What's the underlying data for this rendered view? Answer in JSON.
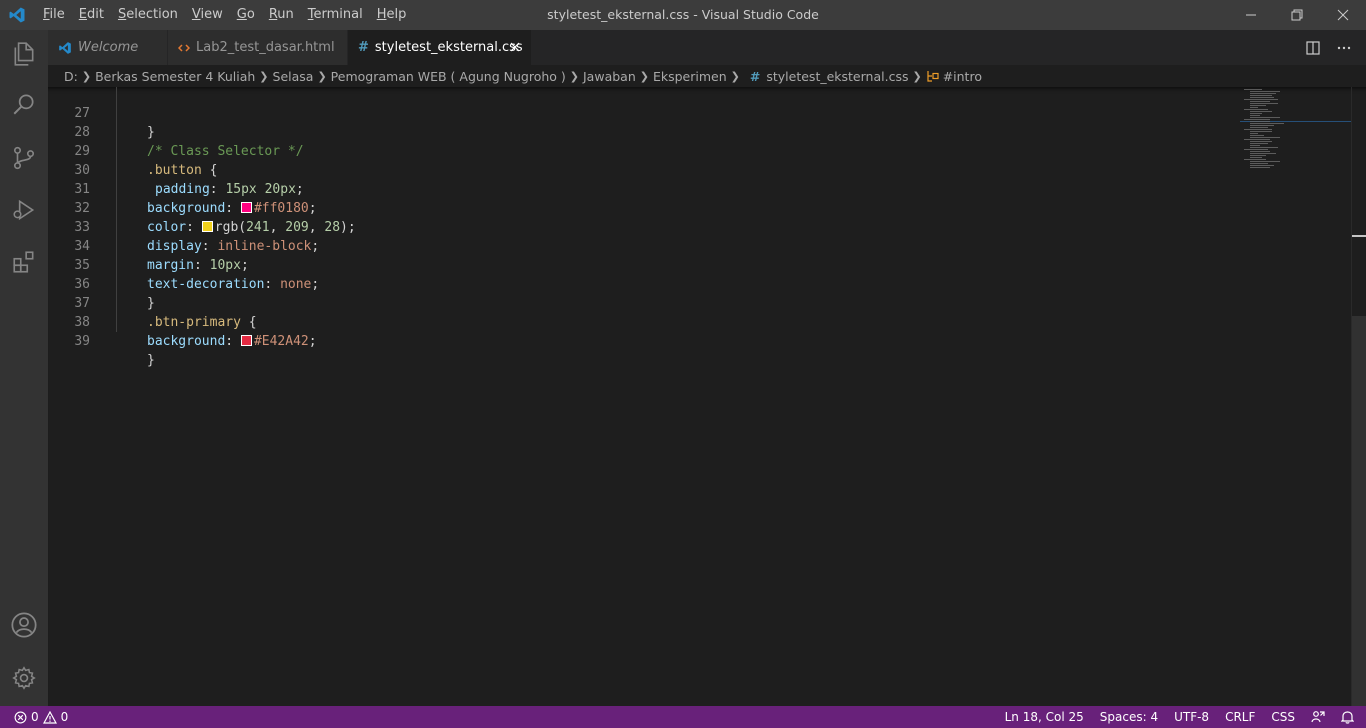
{
  "titlebar": {
    "title": "styletest_eksternal.css - Visual Studio Code",
    "menu": [
      {
        "mn": "F",
        "rest": "ile"
      },
      {
        "mn": "E",
        "rest": "dit"
      },
      {
        "mn": "S",
        "rest": "election"
      },
      {
        "mn": "V",
        "rest": "iew"
      },
      {
        "mn": "G",
        "rest": "o"
      },
      {
        "mn": "R",
        "rest": "un"
      },
      {
        "mn": "T",
        "rest": "erminal"
      },
      {
        "mn": "H",
        "rest": "elp"
      }
    ]
  },
  "activitybar": {
    "icons": [
      "explorer-icon",
      "search-icon",
      "source-control-icon",
      "run-debug-icon",
      "extensions-icon",
      "account-icon",
      "settings-gear-icon"
    ]
  },
  "tabs": [
    {
      "label": "Welcome",
      "icon": "vscode-logo-icon",
      "active": false
    },
    {
      "label": "Lab2_test_dasar.html",
      "icon": "html-file-icon",
      "active": false
    },
    {
      "label": "styletest_eksternal.css",
      "icon": "css-file-icon",
      "active": true
    }
  ],
  "breadcrumb": {
    "parts": [
      "D:",
      "Berkas Semester 4 Kuliah",
      "Selasa",
      "Pemograman WEB ( Agung Nugroho )",
      "Jawaban",
      "Eksperimen"
    ],
    "file": "styletest_eksternal.css",
    "symbol": "#intro"
  },
  "editor": {
    "lines": [
      {
        "num": "27",
        "text": "}"
      },
      {
        "num": "28",
        "text": "/* Class Selector */"
      },
      {
        "num": "29",
        "text": ".button {"
      },
      {
        "num": "30",
        "text": "padding: 15px 20px;"
      },
      {
        "num": "31",
        "text": "background: #ff0180;"
      },
      {
        "num": "32",
        "text": "color: rgb(241, 209, 28);"
      },
      {
        "num": "33",
        "text": "display: inline-block;"
      },
      {
        "num": "34",
        "text": "margin: 10px;"
      },
      {
        "num": "35",
        "text": "text-decoration: none;"
      },
      {
        "num": "36",
        "text": "}"
      },
      {
        "num": "37",
        "text": ".btn-primary {"
      },
      {
        "num": "38",
        "text": "background: #E42A42;"
      },
      {
        "num": "39",
        "text": "}"
      }
    ],
    "swatches": {
      "line31": "#ff0180",
      "line32": "#f1d11c",
      "line38": "#E42A42"
    }
  },
  "statusbar": {
    "errors": "0",
    "warnings": "0",
    "position": "Ln 18, Col 25",
    "spaces": "Spaces: 4",
    "encoding": "UTF-8",
    "eol": "CRLF",
    "language": "CSS",
    "color": "#68217a"
  }
}
